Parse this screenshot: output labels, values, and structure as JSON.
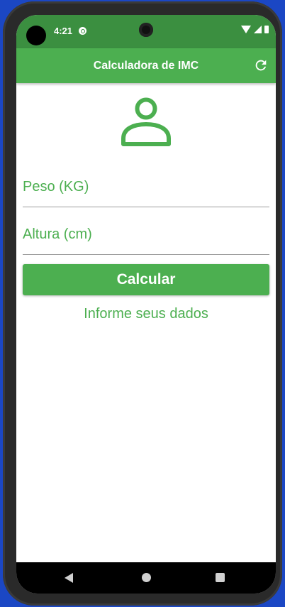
{
  "status_bar": {
    "time": "4:21"
  },
  "app_bar": {
    "title": "Calculadora de IMC"
  },
  "form": {
    "weight_label": "Peso (KG)",
    "height_label": "Altura (cm)",
    "calculate_label": "Calcular",
    "info_text": "Informe seus dados"
  },
  "icons": {
    "refresh": "refresh-icon",
    "person": "person-outline-icon",
    "back": "back-icon",
    "home": "home-icon",
    "recents": "recents-icon"
  },
  "colors": {
    "primary": "#4caf50",
    "status_bar": "#3b8f40",
    "divider": "#9e9e9e"
  }
}
